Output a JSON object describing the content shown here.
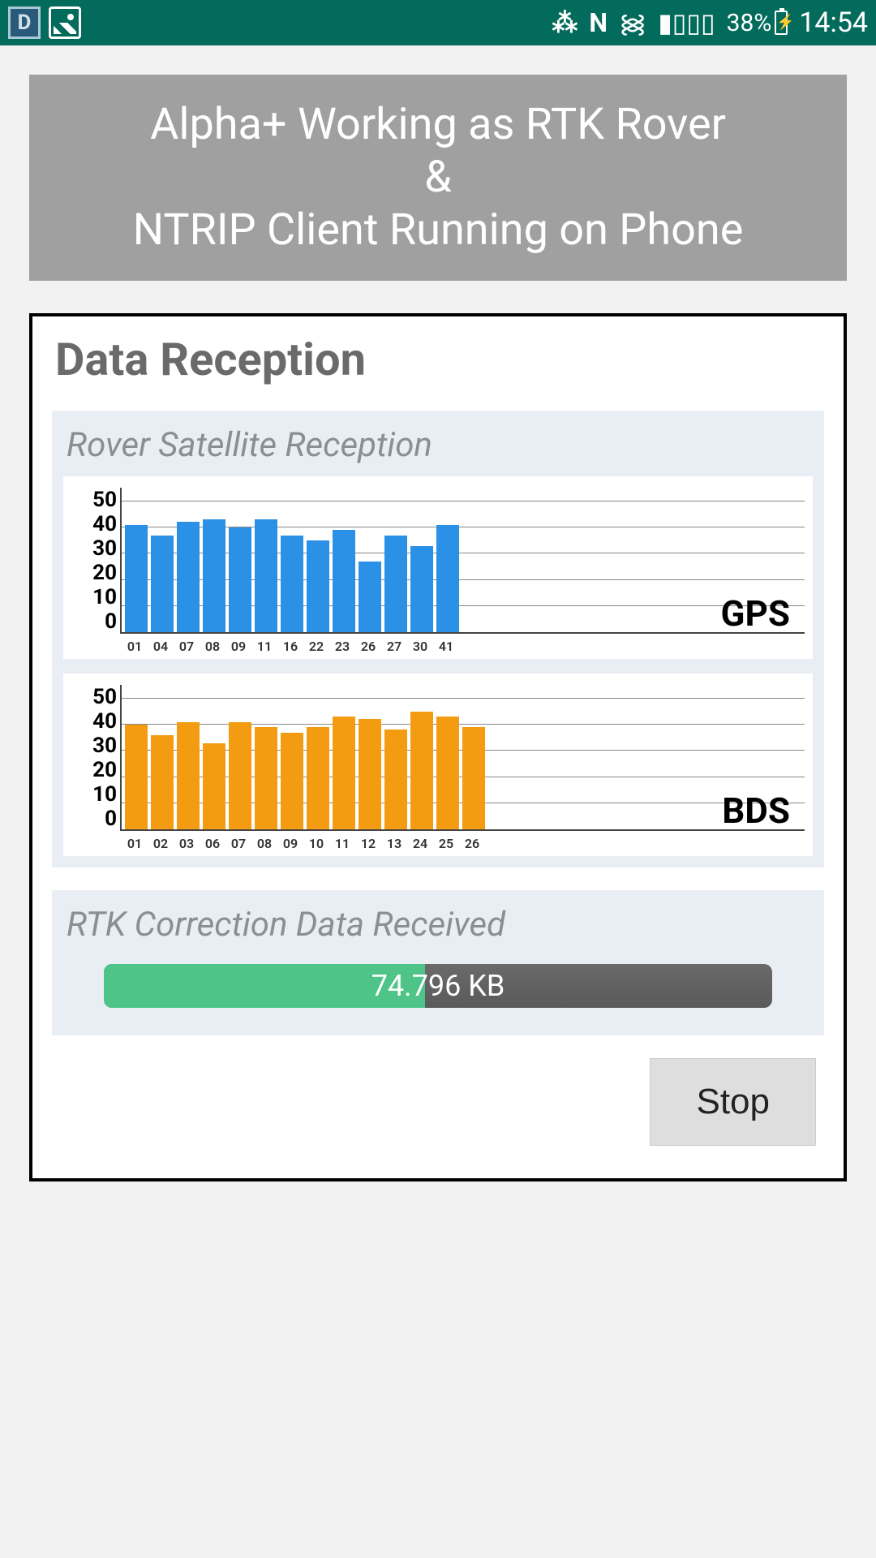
{
  "status_bar": {
    "battery_pct": "38%",
    "time": "14:54",
    "n_label": "N"
  },
  "title_card": {
    "line1": "Alpha+ Working as RTK Rover",
    "line2": "&",
    "line3": "NTRIP Client Running on Phone"
  },
  "panel": {
    "title": "Data Reception"
  },
  "sat_section": {
    "title": "Rover Satellite Reception"
  },
  "rtk_section": {
    "title": "RTK Correction Data Received",
    "value": "74.796 KB"
  },
  "stop_button": {
    "label": "Stop"
  },
  "chart_data": [
    {
      "type": "bar",
      "series_name": "GPS",
      "categories": [
        "01",
        "04",
        "07",
        "08",
        "09",
        "11",
        "16",
        "22",
        "23",
        "26",
        "27",
        "30",
        "41"
      ],
      "values": [
        41,
        37,
        42,
        43,
        40,
        43,
        37,
        35,
        39,
        27,
        37,
        33,
        41
      ],
      "y_ticks": [
        0,
        10,
        20,
        30,
        40,
        50
      ],
      "ylim": [
        0,
        55
      ],
      "color": "#2a91e6"
    },
    {
      "type": "bar",
      "series_name": "BDS",
      "categories": [
        "01",
        "02",
        "03",
        "06",
        "07",
        "08",
        "09",
        "10",
        "11",
        "12",
        "13",
        "24",
        "25",
        "26"
      ],
      "values": [
        40,
        36,
        41,
        33,
        41,
        39,
        37,
        39,
        43,
        42,
        38,
        45,
        43,
        39
      ],
      "y_ticks": [
        0,
        10,
        20,
        30,
        40,
        50
      ],
      "ylim": [
        0,
        55
      ],
      "color": "#f39c12"
    }
  ]
}
